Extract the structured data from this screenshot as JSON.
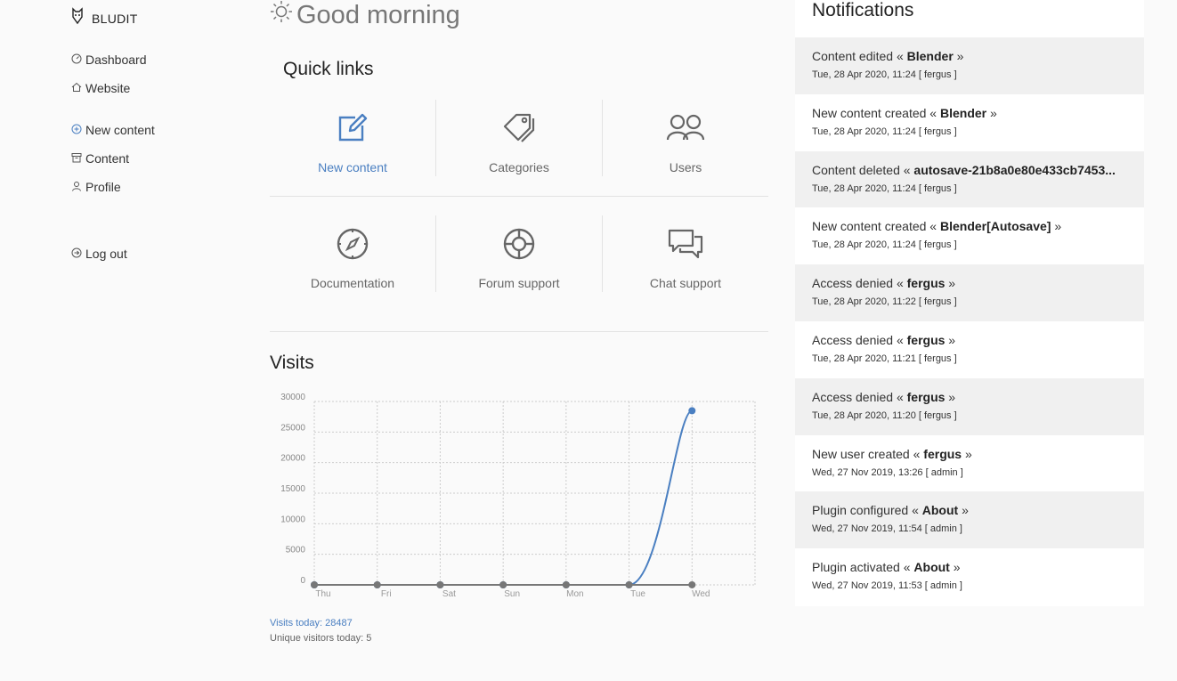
{
  "brand": {
    "name": "BLUDIT",
    "logo_icon": "bludit-logo"
  },
  "sidebar": {
    "items": [
      {
        "label": "Dashboard",
        "icon": "speedometer-icon"
      },
      {
        "label": "Website",
        "icon": "home-icon"
      },
      {
        "label": "New content",
        "icon": "plus-circle-icon"
      },
      {
        "label": "Content",
        "icon": "archive-icon"
      },
      {
        "label": "Profile",
        "icon": "user-icon"
      },
      {
        "label": "Log out",
        "icon": "logout-icon"
      }
    ]
  },
  "main": {
    "greeting": "Good morning",
    "quick_links_title": "Quick links",
    "quick_links": [
      {
        "label": "New content",
        "icon": "edit-icon"
      },
      {
        "label": "Categories",
        "icon": "tag-icon"
      },
      {
        "label": "Users",
        "icon": "users-icon"
      },
      {
        "label": "Documentation",
        "icon": "compass-icon"
      },
      {
        "label": "Forum support",
        "icon": "lifebuoy-icon"
      },
      {
        "label": "Chat support",
        "icon": "chat-icon"
      }
    ],
    "visits_title": "Visits",
    "visits_today": "Visits today: 28487",
    "unique_visitors": "Unique visitors today: 5"
  },
  "chart_data": {
    "type": "line",
    "categories": [
      "Thu",
      "Fri",
      "Sat",
      "Sun",
      "Mon",
      "Tue",
      "Wed"
    ],
    "series": [
      {
        "values": [
          0,
          0,
          0,
          0,
          0,
          0,
          28487
        ],
        "color": "#4a7fc1"
      },
      {
        "values": [
          0,
          0,
          0,
          0,
          0,
          0,
          5
        ],
        "color": "#777777"
      }
    ],
    "ylim": [
      0,
      30000
    ],
    "yticks": [
      0,
      5000,
      10000,
      15000,
      20000,
      25000,
      30000
    ],
    "grid": true
  },
  "notifications": {
    "title": "Notifications",
    "items": [
      {
        "prefix": "Content edited « ",
        "subject": "Blender",
        "suffix": " »",
        "meta": "Tue, 28 Apr 2020, 11:24 [ fergus ]"
      },
      {
        "prefix": "New content created « ",
        "subject": "Blender",
        "suffix": " »",
        "meta": "Tue, 28 Apr 2020, 11:24 [ fergus ]"
      },
      {
        "prefix": "Content deleted « ",
        "subject": "autosave-21b8a0e80e433cb7453...",
        "suffix": "",
        "meta": "Tue, 28 Apr 2020, 11:24 [ fergus ]"
      },
      {
        "prefix": "New content created « ",
        "subject": "Blender[Autosave]",
        "suffix": " »",
        "meta": "Tue, 28 Apr 2020, 11:24 [ fergus ]"
      },
      {
        "prefix": "Access denied « ",
        "subject": "fergus",
        "suffix": " »",
        "meta": "Tue, 28 Apr 2020, 11:22 [ fergus ]"
      },
      {
        "prefix": "Access denied « ",
        "subject": "fergus",
        "suffix": " »",
        "meta": "Tue, 28 Apr 2020, 11:21 [ fergus ]"
      },
      {
        "prefix": "Access denied « ",
        "subject": "fergus",
        "suffix": " »",
        "meta": "Tue, 28 Apr 2020, 11:20 [ fergus ]"
      },
      {
        "prefix": "New user created « ",
        "subject": "fergus",
        "suffix": " »",
        "meta": "Wed, 27 Nov 2019, 13:26 [ admin ]"
      },
      {
        "prefix": "Plugin configured « ",
        "subject": "About",
        "suffix": " »",
        "meta": "Wed, 27 Nov 2019, 11:54 [ admin ]"
      },
      {
        "prefix": "Plugin activated « ",
        "subject": "About",
        "suffix": " »",
        "meta": "Wed, 27 Nov 2019, 11:53 [ admin ]"
      }
    ]
  }
}
